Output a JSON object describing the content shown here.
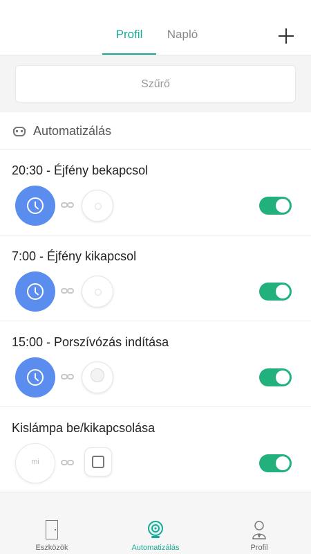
{
  "header": {
    "tabs": [
      {
        "label": "Profil",
        "active": true
      },
      {
        "label": "Napló",
        "active": false
      }
    ],
    "add_icon": "plus-icon"
  },
  "filter": {
    "label": "Szűrő"
  },
  "section": {
    "title": "Automatizálás",
    "icon": "robot-icon"
  },
  "automations": [
    {
      "title": "20:30 - Éjfény bekapcsol",
      "trigger": "clock-icon",
      "device": "night-light-icon",
      "enabled": true
    },
    {
      "title": "7:00 - Éjfény kikapcsol",
      "trigger": "clock-icon",
      "device": "night-light-icon",
      "enabled": true
    },
    {
      "title": "15:00 - Porszívózás indítása",
      "trigger": "clock-icon",
      "device": "robot-vacuum-icon",
      "enabled": true
    },
    {
      "title": "Kislámpa be/kikapcsolása",
      "trigger": "mi-button-icon",
      "trigger_text": "mi",
      "device": "smart-socket-icon",
      "enabled": true
    }
  ],
  "bottom_nav": [
    {
      "label": "Eszközök",
      "icon": "door-icon",
      "active": false
    },
    {
      "label": "Automatizálás",
      "icon": "automation-icon",
      "active": true
    },
    {
      "label": "Profil",
      "icon": "profile-icon",
      "active": false
    }
  ],
  "colors": {
    "accent": "#1aa896",
    "toggle_on": "#22b07d",
    "clock_trigger": "#5b8def"
  }
}
